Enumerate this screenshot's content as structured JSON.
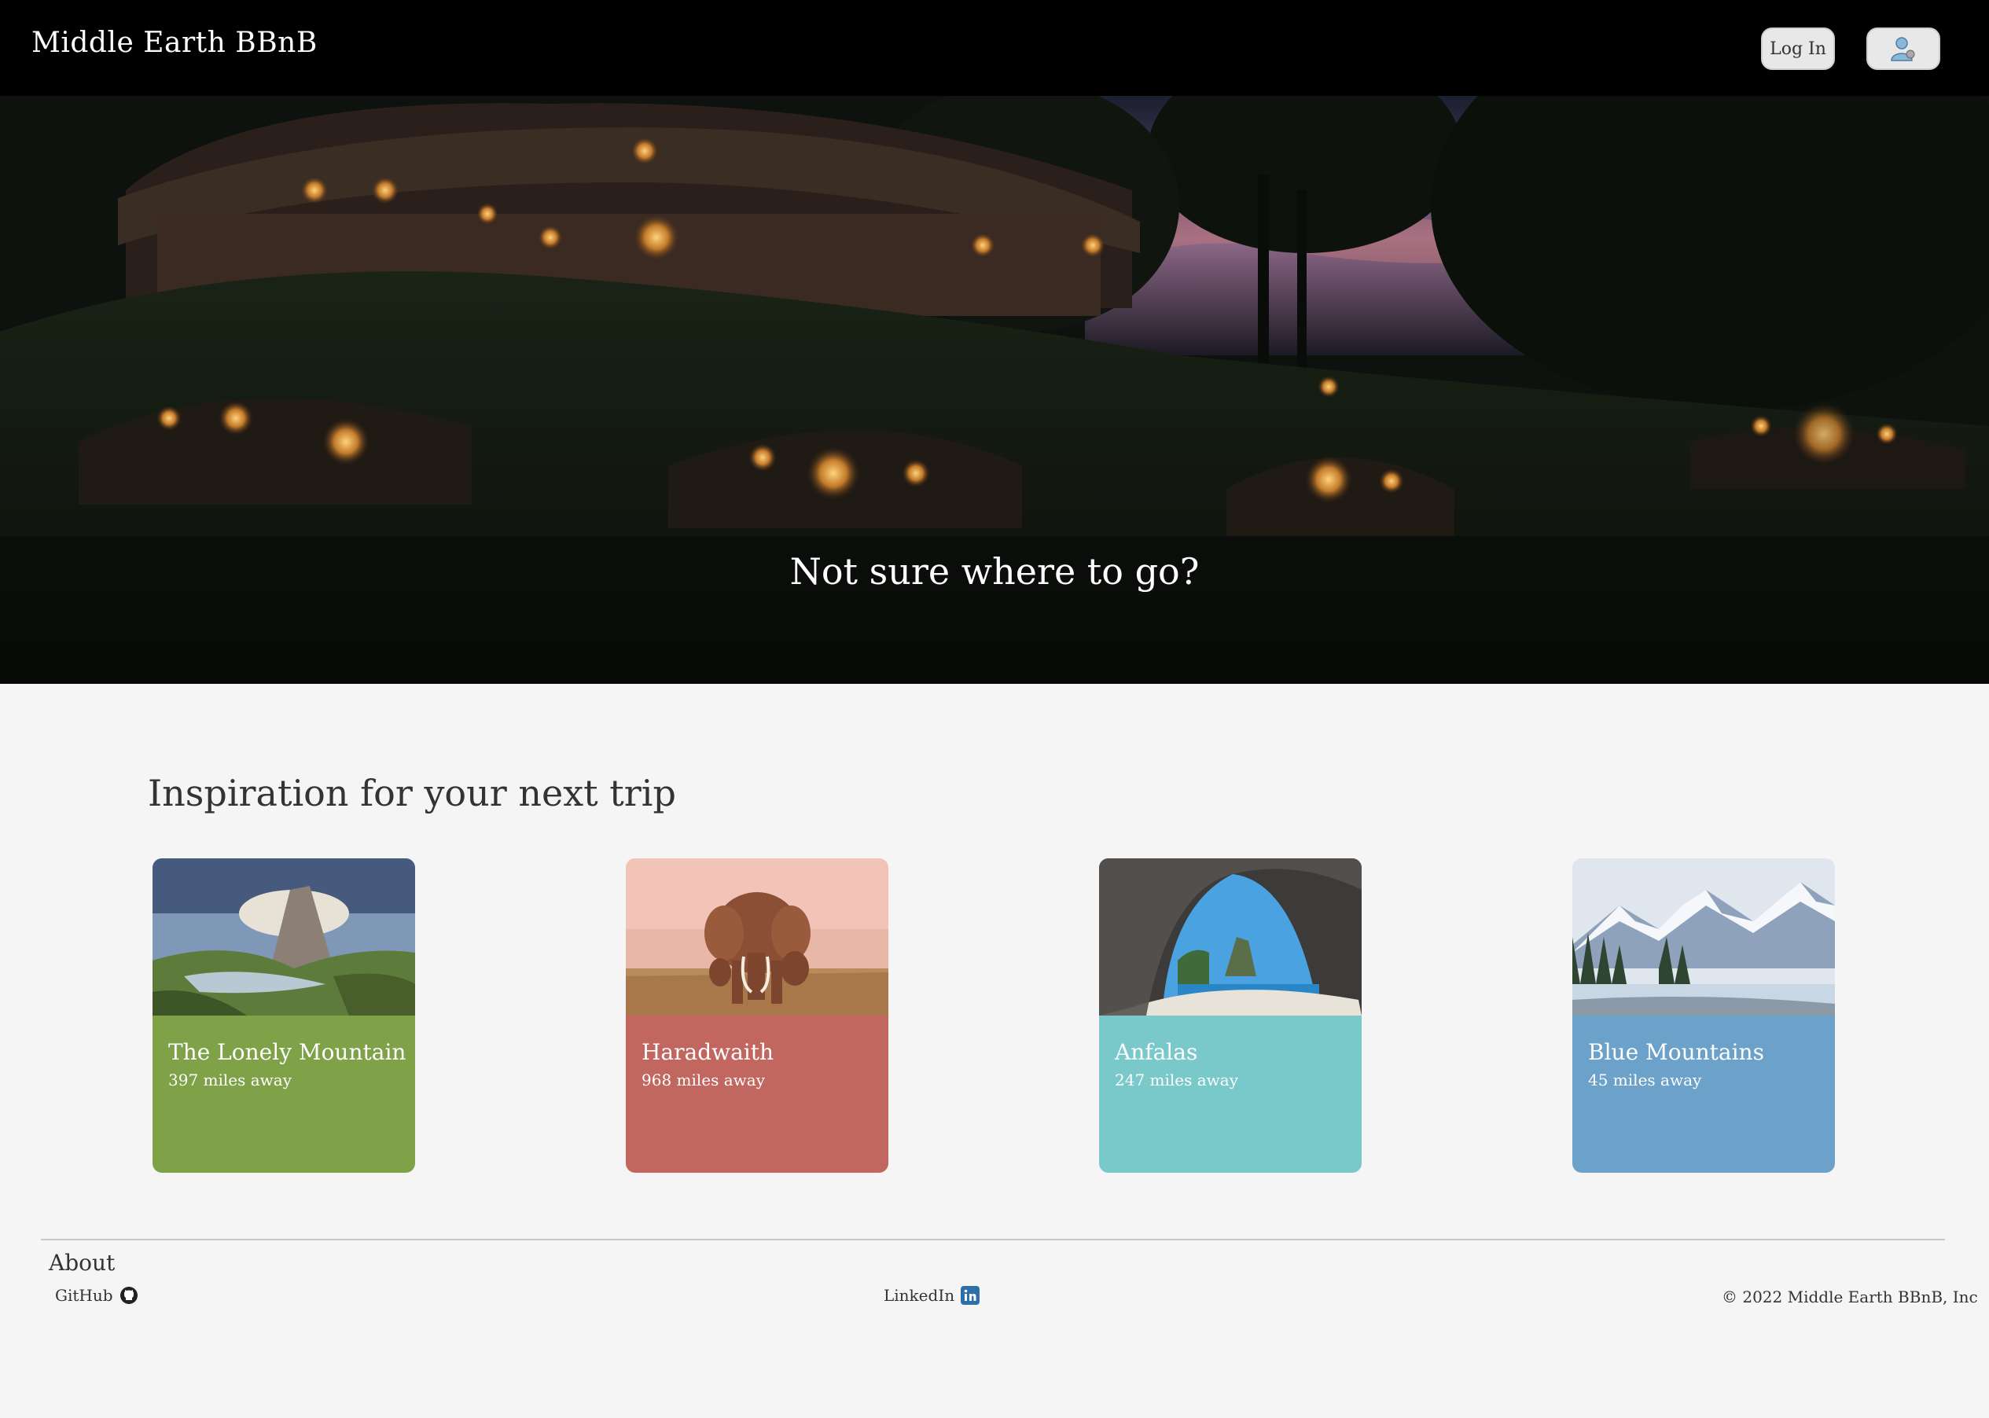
{
  "header": {
    "brand": "Middle Earth BBnB",
    "login_label": "Log In",
    "user_icon": "user-avatar-icon"
  },
  "hero": {
    "tagline": "Not sure where to go?"
  },
  "inspiration": {
    "title": "Inspiration for your next trip",
    "cards": [
      {
        "name": "The Lonely Mountain",
        "distance": "397 miles away",
        "color": "#7fa147"
      },
      {
        "name": "Haradwaith",
        "distance": "968 miles away",
        "color": "#c26660"
      },
      {
        "name": "Anfalas",
        "distance": "247 miles away",
        "color": "#79c8ca"
      },
      {
        "name": "Blue Mountains",
        "distance": "45 miles away",
        "color": "#6ca2c9"
      }
    ]
  },
  "footer": {
    "about": "About",
    "github": "GitHub",
    "linkedin": "LinkedIn",
    "copyright": "© 2022 Middle Earth BBnB, Inc"
  }
}
